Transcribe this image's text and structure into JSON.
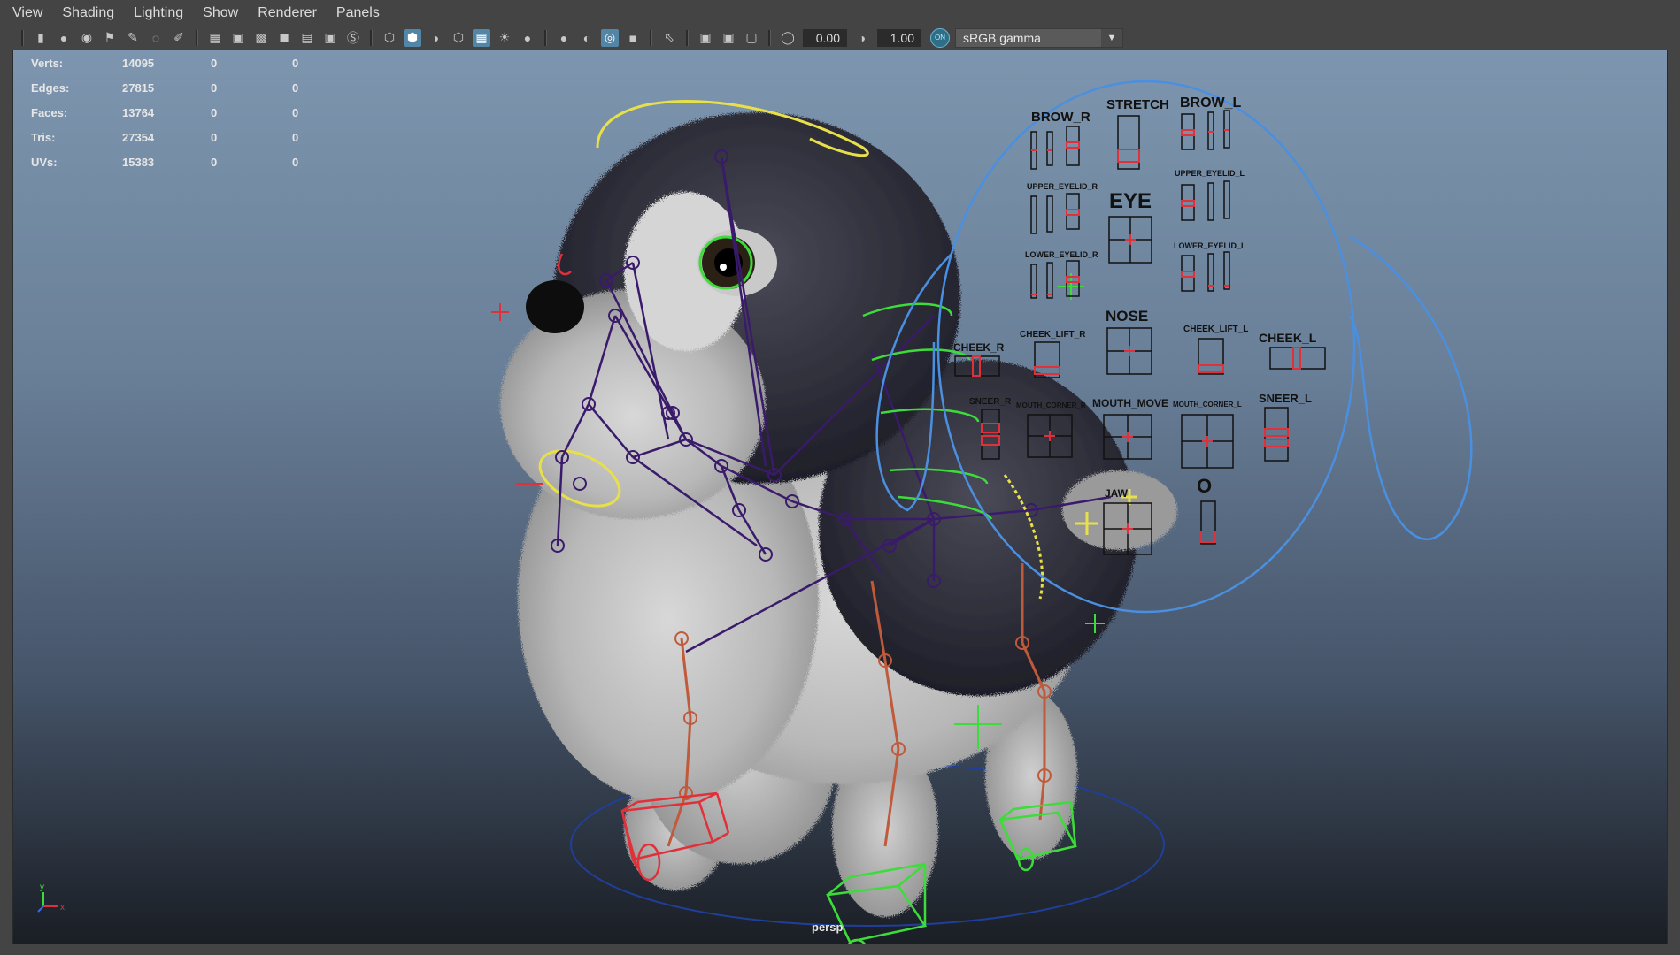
{
  "menubar": {
    "items": [
      "View",
      "Shading",
      "Lighting",
      "Show",
      "Renderer",
      "Panels"
    ]
  },
  "toolbar": {
    "exposure_value": "0.00",
    "gamma_value": "1.00",
    "toggle_label": "ON",
    "colorspace_selected": "sRGB gamma"
  },
  "hud": {
    "rows": [
      {
        "label": "Verts:",
        "value": "14095",
        "c2": "0",
        "c3": "0"
      },
      {
        "label": "Edges:",
        "value": "27815",
        "c2": "0",
        "c3": "0"
      },
      {
        "label": "Faces:",
        "value": "13764",
        "c2": "0",
        "c3": "0"
      },
      {
        "label": "Tris:",
        "value": "27354",
        "c2": "0",
        "c3": "0"
      },
      {
        "label": "UVs:",
        "value": "15383",
        "c2": "0",
        "c3": "0"
      }
    ]
  },
  "viewport": {
    "camera": "persp",
    "axis_y": "y",
    "axis_x": "x"
  },
  "face_panel": {
    "labels": {
      "brow_r": "BROW_R",
      "stretch": "STRETCH",
      "brow_l": "BROW_L",
      "upper_eyelid_r": "UPPER_EYELID_R",
      "eye": "EYE",
      "upper_eyelid_l": "UPPER_EYELID_L",
      "lower_eyelid_r": "LOWER_EYELID_R",
      "lower_eyelid_l": "LOWER_EYELID_L",
      "cheek_lift_r": "CHEEK_LIFT_R",
      "nose": "NOSE",
      "cheek_lift_l": "CHEEK_LIFT_L",
      "cheek_r": "CHEEK_R",
      "cheek_l": "CHEEK_L",
      "sneer_r": "SNEER_R",
      "mouth_corner_r": "MOUTH_CORNER_R",
      "mouth_move": "MOUTH_MOVE",
      "mouth_corner_l": "MOUTH_CORNER_L",
      "sneer_l": "SNEER_L",
      "jaw": "JAW",
      "o": "O"
    }
  },
  "colors": {
    "ui_background": "#444444",
    "active_icon": "#5285a6",
    "control_blue": "#4a8fe0",
    "control_yellow": "#e8e04a",
    "control_green": "#3ddc3a",
    "control_red": "#e0303a",
    "skeleton_purple": "#3a1a6a",
    "leg_joint": "#c05a3a"
  }
}
